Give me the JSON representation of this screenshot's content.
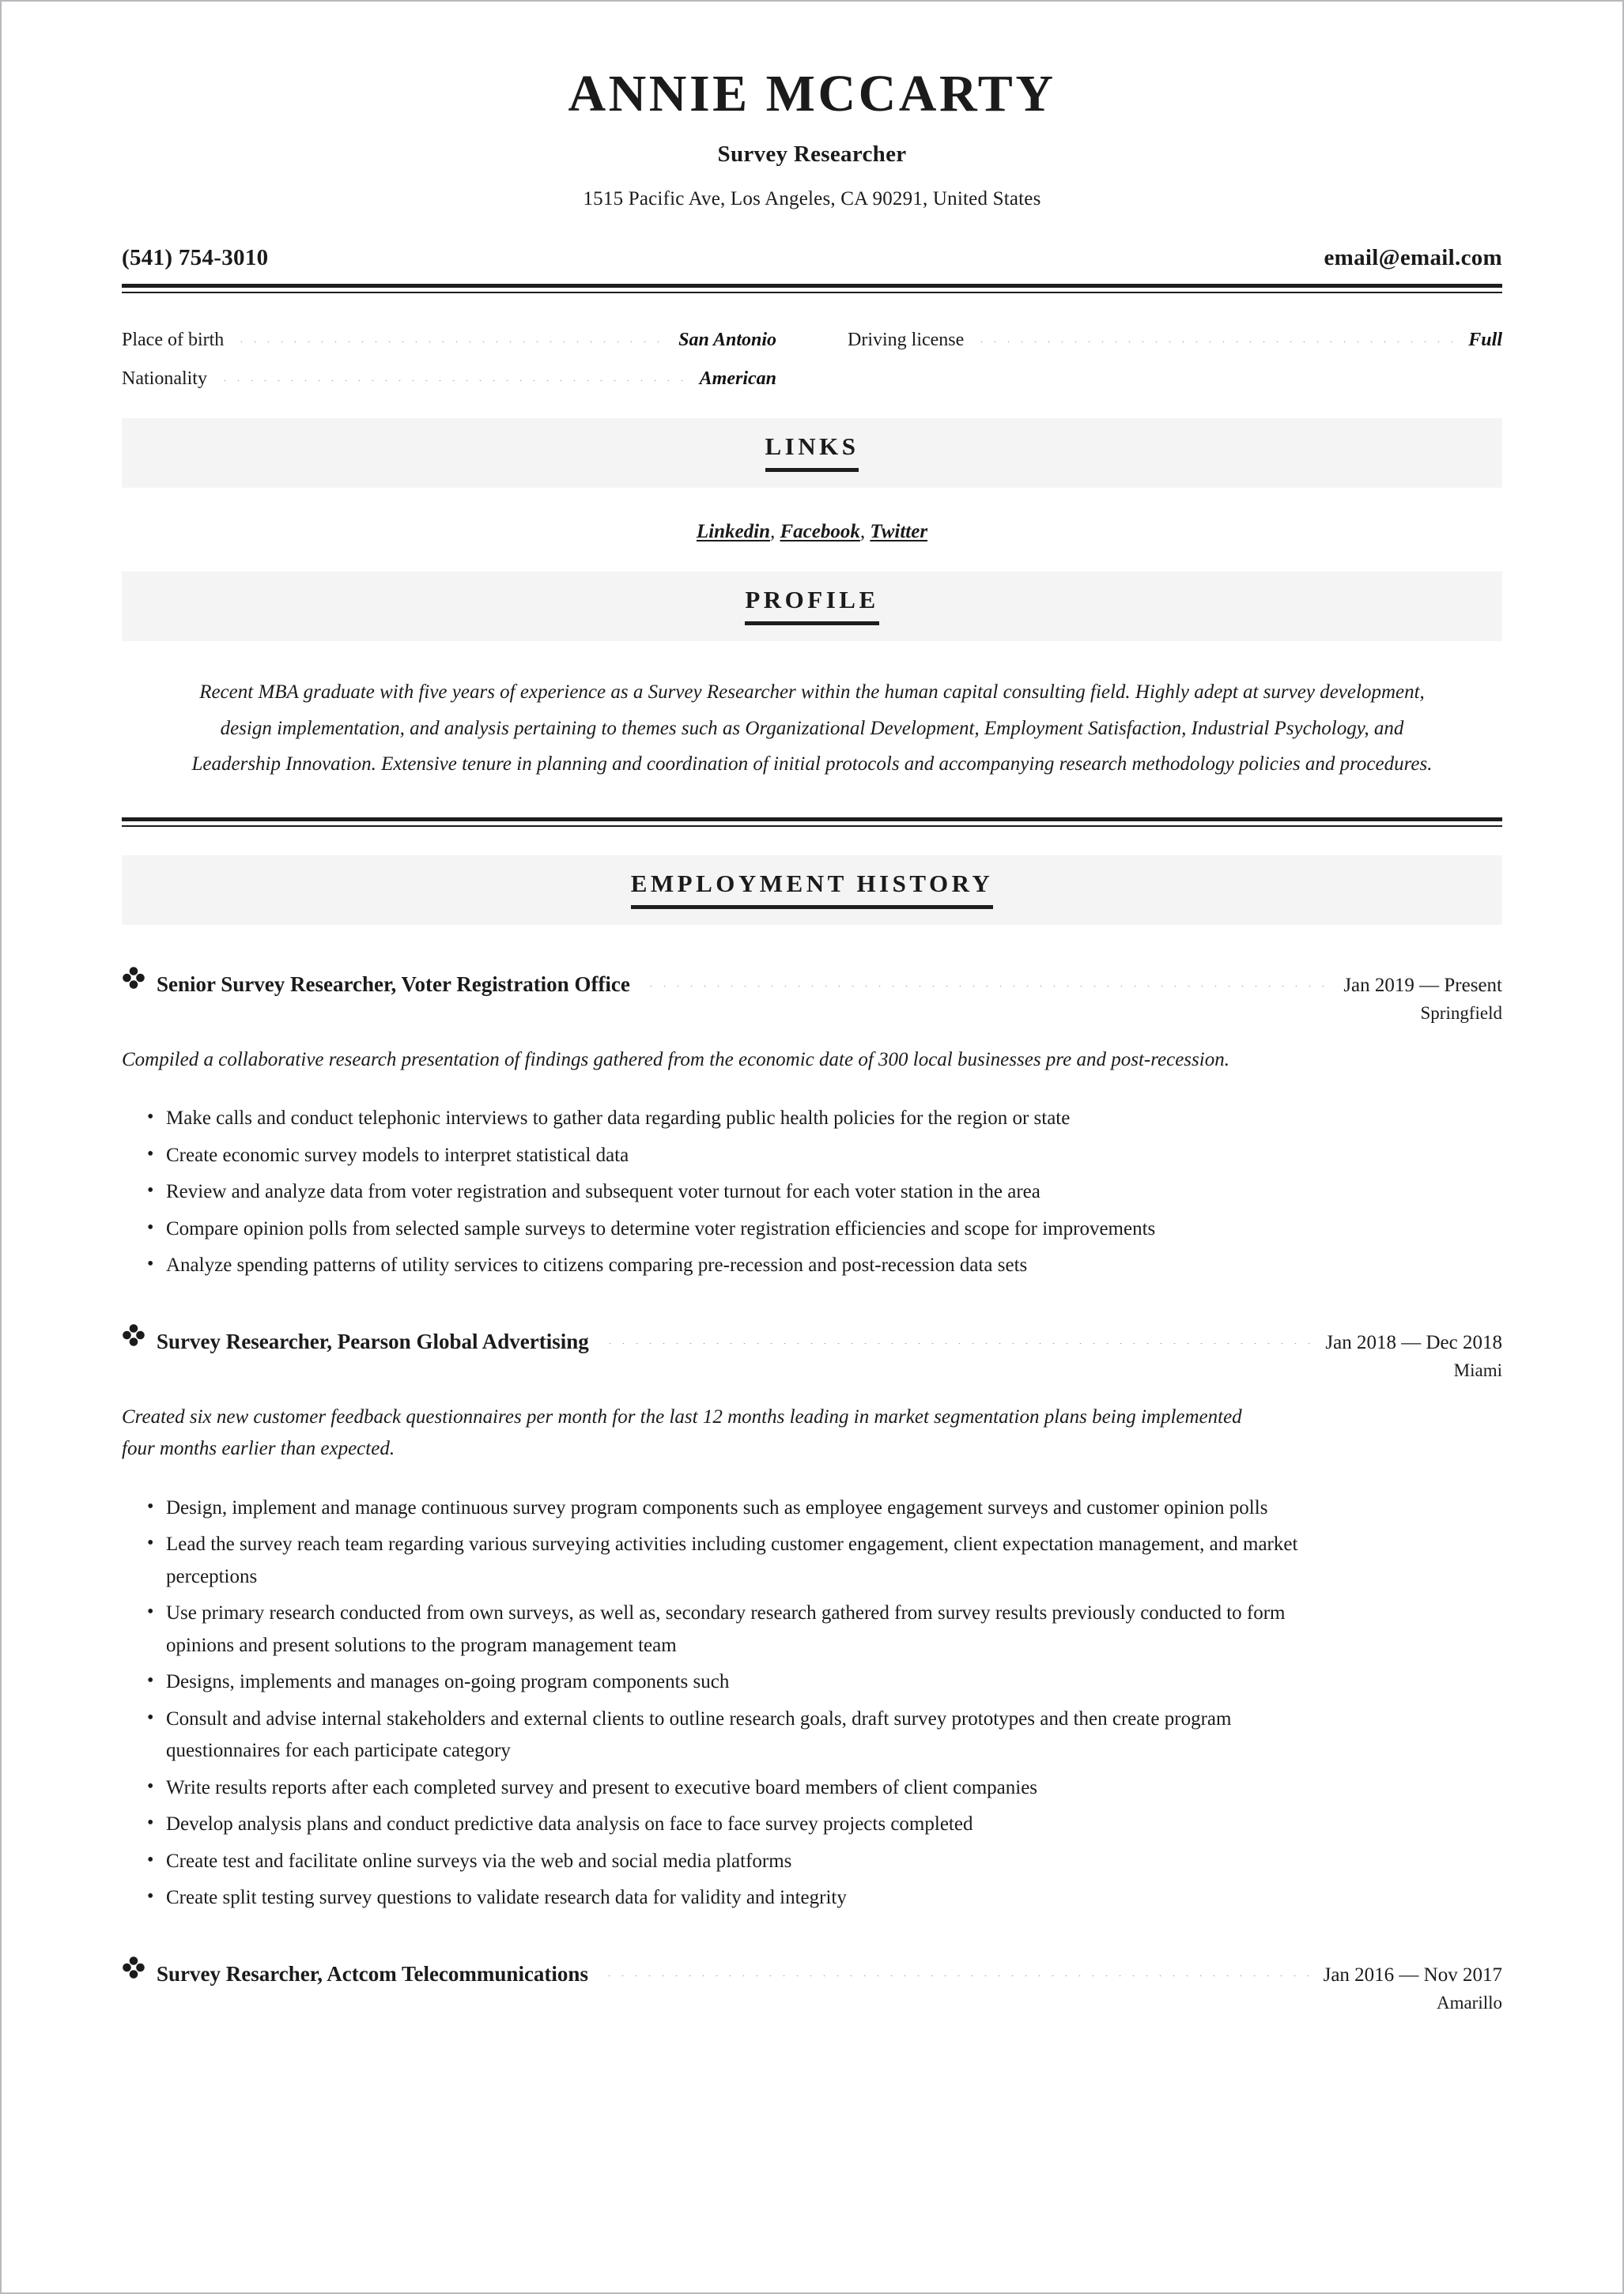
{
  "header": {
    "name": "ANNIE MCCARTY",
    "job_title": "Survey Researcher",
    "address": "1515 Pacific Ave, Los Angeles, CA 90291, United States",
    "phone": "(541) 754-3010",
    "email": "email@email.com"
  },
  "details": [
    {
      "label": "Place of birth",
      "value": "San Antonio"
    },
    {
      "label": "Driving license",
      "value": "Full"
    },
    {
      "label": "Nationality",
      "value": "American"
    }
  ],
  "links_section": {
    "title": "LINKS",
    "items": [
      "Linkedin",
      "Facebook",
      "Twitter"
    ],
    "separator": ", "
  },
  "profile_section": {
    "title": "PROFILE",
    "text": "Recent MBA graduate with five years of experience as a Survey Researcher within the human capital consulting field. Highly adept at survey development, design implementation, and analysis pertaining to themes such as Organizational Development, Employment Satisfaction, Industrial Psychology, and Leadership Innovation. Extensive tenure in planning and coordination of initial protocols and accompanying research methodology policies and procedures."
  },
  "employment_section": {
    "title": "EMPLOYMENT HISTORY",
    "marker_icon": "quatrefoil-icon",
    "jobs": [
      {
        "name": "Senior Survey Researcher, Voter Registration Office",
        "dates": "Jan 2019 — Present",
        "city": "Springfield",
        "summary": "Compiled a collaborative research presentation of findings gathered from the economic date of 300 local businesses pre and post-recession.",
        "bullets": [
          "Make calls and conduct telephonic interviews to gather data regarding public health policies for the region or state",
          "Create economic survey models to interpret statistical data",
          "Review and analyze data from voter registration and subsequent voter turnout for each voter station in the area",
          "Compare opinion polls from selected sample surveys to determine voter registration efficiencies and scope for improvements",
          "Analyze spending patterns of utility services to citizens comparing pre-recession and post-recession data sets"
        ]
      },
      {
        "name": "Survey Researcher, Pearson Global Advertising",
        "dates": "Jan 2018 — Dec 2018",
        "city": "Miami",
        "summary": "Created six new customer feedback questionnaires per month for the last 12 months leading in market segmentation plans being implemented four months earlier than expected.",
        "bullets": [
          "Design, implement and manage continuous survey program components such as employee engagement surveys and customer opinion polls",
          "Lead the survey reach team regarding various surveying activities including customer engagement, client expectation management, and market perceptions",
          "Use primary research conducted from own surveys, as well as, secondary research gathered from survey results previously conducted to form opinions and present solutions to the program management team",
          "Designs, implements and manages on-going program components such",
          "Consult and advise internal stakeholders and external clients to outline research goals, draft survey prototypes and then create program questionnaires for each participate category",
          "Write results reports after each completed survey and present to executive board members of client companies",
          "Develop analysis plans and conduct predictive data analysis on face to face survey projects completed",
          "Create test and facilitate online surveys via the web and social media platforms",
          "Create split testing survey questions to validate research data for validity and integrity"
        ]
      },
      {
        "name": "Survey Resarcher, Actcom Telecommunications",
        "dates": "Jan 2016 — Nov 2017",
        "city": "Amarillo",
        "summary": "",
        "bullets": []
      }
    ]
  },
  "colors": {
    "text": "#1b1b1b",
    "band": "#f4f4f4",
    "rule": "#1d1d1d",
    "page_border": "#b9b9bd"
  }
}
